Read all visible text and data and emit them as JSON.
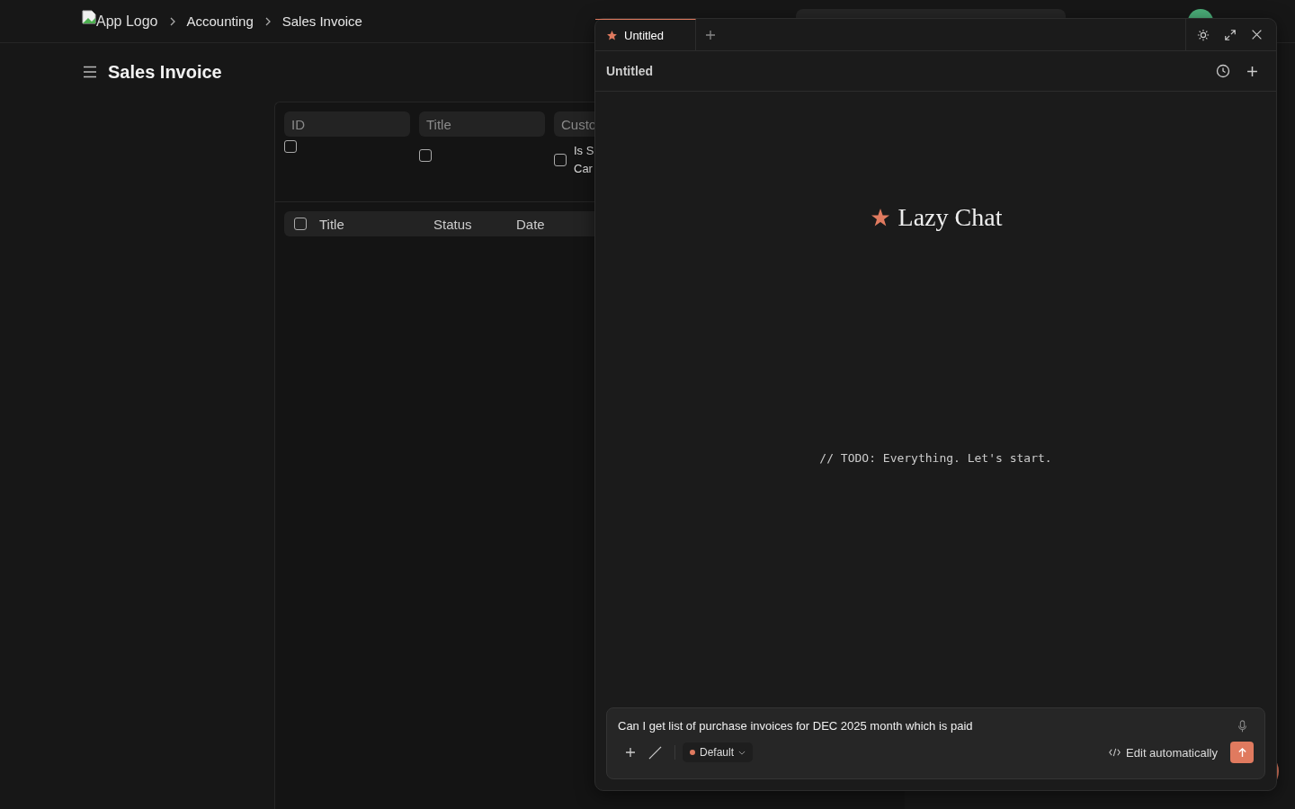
{
  "topbar": {
    "logo_alt": "App Logo",
    "breadcrumbs": [
      "Accounting",
      "Sales Invoice"
    ]
  },
  "page": {
    "title": "Sales Invoice"
  },
  "filters": {
    "fields": [
      {
        "placeholder": "ID"
      },
      {
        "placeholder": "Title"
      },
      {
        "placeholder": "Custo"
      }
    ],
    "checkboxes": [
      {
        "checked": false
      },
      {
        "checked": false
      },
      {
        "checked": false,
        "label": "Is S Car"
      }
    ]
  },
  "table": {
    "header_checked": false,
    "columns": [
      "Title",
      "Status",
      "Date"
    ]
  },
  "chat": {
    "tabs": [
      {
        "label": "Untitled",
        "selected": true
      }
    ],
    "title": "Untitled",
    "heading": "Lazy Chat",
    "empty_note": "// TODO: Everything. Let's start.",
    "composer": {
      "value": "Can I get list of purchase invoices for DEC 2025 month which is paid",
      "mode": {
        "label": "Default",
        "color": "#e07a5f"
      },
      "action": "Edit automatically"
    }
  }
}
